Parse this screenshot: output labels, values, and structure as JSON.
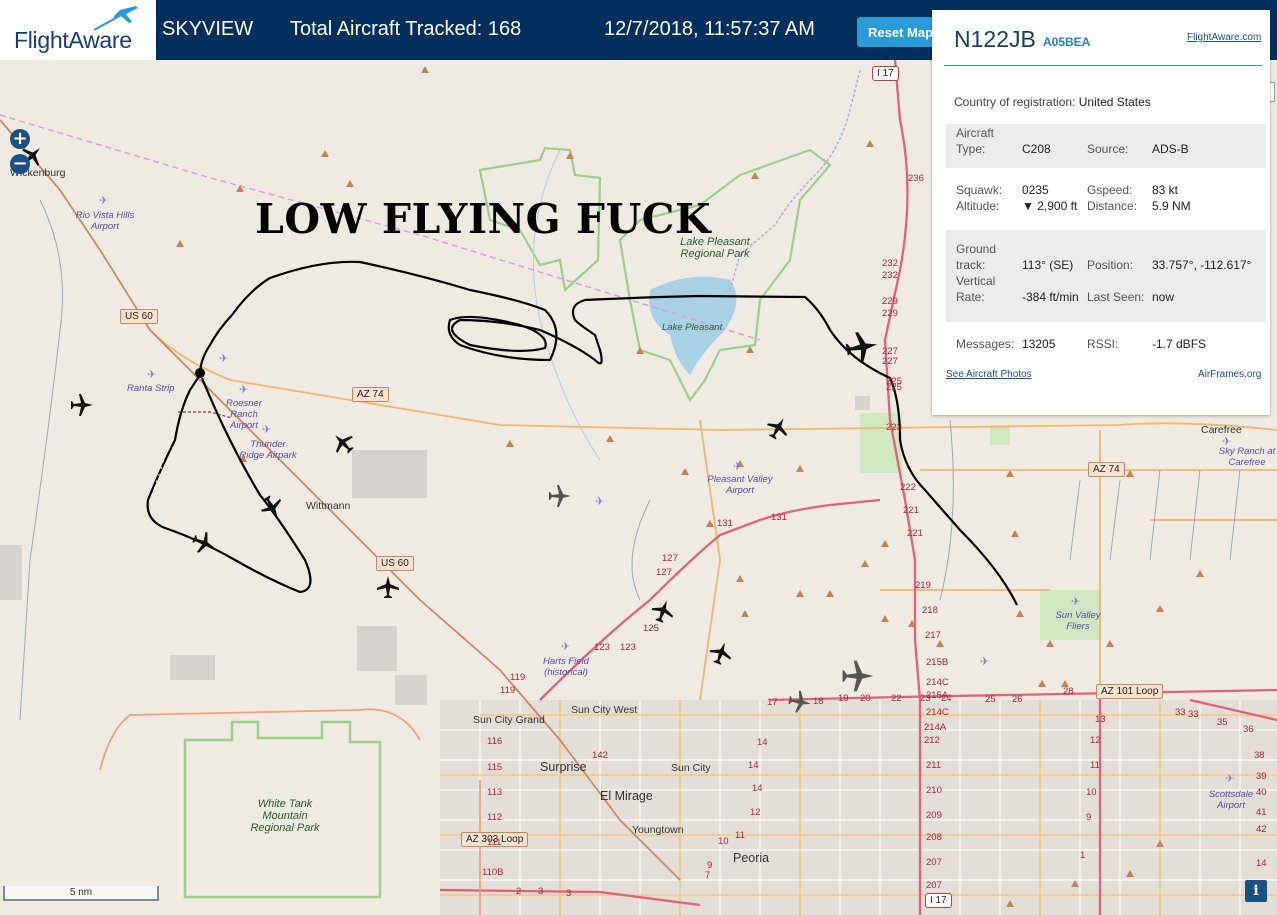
{
  "header": {
    "logo_text": "FlightAware",
    "app_name": "SKYVIEW",
    "tracked": "Total Aircraft Tracked: 168",
    "datetime": "12/7/2018, 11:57:37 AM",
    "reset_label": "Reset Map"
  },
  "map": {
    "zoom_in": "+",
    "zoom_out": "−",
    "scale_label": "5 nm",
    "info_label": "i",
    "overlay_text": "LOW FLYING FUCK",
    "places": [
      {
        "id": "wickenburg",
        "text": "Wickenburg"
      },
      {
        "id": "wittmann",
        "text": "Wittmann"
      },
      {
        "id": "sun-city-grand",
        "text": "Sun City Grand"
      },
      {
        "id": "sun-city-west",
        "text": "Sun City West"
      },
      {
        "id": "surprise",
        "text": "Surprise"
      },
      {
        "id": "sun-city",
        "text": "Sun City"
      },
      {
        "id": "el-mirage",
        "text": "El Mirage"
      },
      {
        "id": "youngtown",
        "text": "Youngtown"
      },
      {
        "id": "peoria",
        "text": "Peoria"
      },
      {
        "id": "carefree",
        "text": "Carefree"
      },
      {
        "id": "lake-pleasant",
        "text": "Lake Pleasant"
      }
    ],
    "parks": [
      {
        "id": "lake-pleasant-park",
        "text": "Lake Pleasant Regional Park"
      },
      {
        "id": "white-tank",
        "text": "White Tank Mountain Regional Park"
      }
    ],
    "airports": [
      {
        "id": "rio-vista",
        "text": "Rio Vista Hills Airport"
      },
      {
        "id": "ranta",
        "text": "Ranta Strip"
      },
      {
        "id": "roesner",
        "text": "Roesner Ranch Airport"
      },
      {
        "id": "thunder",
        "text": "Thunder Ridge Airpark"
      },
      {
        "id": "pleasant-valley",
        "text": "Pleasant Valley Airport"
      },
      {
        "id": "harts",
        "text": "Harts Field (historical)"
      },
      {
        "id": "sun-valley",
        "text": "Sun Valley Fliers"
      },
      {
        "id": "sky-ranch",
        "text": "Sky Ranch at Carefree"
      },
      {
        "id": "scottsdale",
        "text": "Scottsdale Airport"
      }
    ],
    "shields": [
      {
        "id": "us60-a",
        "text": "US 60"
      },
      {
        "id": "us60-b",
        "text": "US 60"
      },
      {
        "id": "az74-a",
        "text": "AZ 74"
      },
      {
        "id": "az74-b",
        "text": "AZ 74"
      },
      {
        "id": "i17-top",
        "text": "I 17"
      },
      {
        "id": "i17-bottom",
        "text": "I 17"
      },
      {
        "id": "az101",
        "text": "AZ 101 Loop"
      },
      {
        "id": "az303",
        "text": "AZ 303 Loop"
      }
    ],
    "exits": [
      "236",
      "232",
      "232",
      "229",
      "229",
      "227",
      "227",
      "225",
      "225",
      "223",
      "222",
      "221",
      "221",
      "219",
      "218",
      "217",
      "215B",
      "214C",
      "215A",
      "214C",
      "214A",
      "212",
      "211",
      "210",
      "209",
      "208",
      "207",
      "207",
      "131",
      "131",
      "127",
      "127",
      "125",
      "123",
      "123",
      "119",
      "119",
      "116",
      "115",
      "113",
      "112",
      "111",
      "110B",
      "142",
      "14",
      "14",
      "14",
      "12",
      "11",
      "10",
      "9",
      "7",
      "17",
      "18",
      "19",
      "20",
      "22",
      "23",
      "24",
      "25",
      "26",
      "28",
      "33",
      "33",
      "35",
      "36",
      "38",
      "39",
      "40",
      "41",
      "42",
      "14",
      "13",
      "12",
      "11",
      "10",
      "9",
      "1",
      "2",
      "3",
      "3"
    ]
  },
  "panel": {
    "callsign": "N122JB",
    "hex": "A05BEA",
    "fa_link": "FlightAware.com",
    "country_label": "Country of registration:",
    "country_value": "United States",
    "aircraft_type_label_1": "Aircraft",
    "aircraft_type_label_2": "Type:",
    "aircraft_type": "C208",
    "source_label": "Source:",
    "source": "ADS-B",
    "squawk_label": "Squawk:",
    "squawk": "0235",
    "altitude_label": "Altitude:",
    "altitude": "▼ 2,900 ft",
    "gspeed_label": "Gspeed:",
    "gspeed": "83 kt",
    "distance_label": "Distance:",
    "distance": "5.9 NM",
    "track_label_1": "Ground",
    "track_label_2": "track:",
    "track": "113° (SE)",
    "position_label": "Position:",
    "position": "33.757°, -112.617°",
    "vrate_label_1": "Vertical",
    "vrate_label_2": "Rate:",
    "vrate": "-384 ft/min",
    "lastseen_label": "Last Seen:",
    "lastseen": "now",
    "messages_label": "Messages:",
    "messages": "13205",
    "rssi_label": "RSSI:",
    "rssi": "-1.7 dBFS",
    "photos_link": "See Aircraft Photos",
    "airframes_link": "AirFrames.org"
  },
  "colors": {
    "header_bg": "#002f5d",
    "accent": "#2a9ad8",
    "interstate": "#e2607a",
    "arterial": "#f2b56b",
    "park_border": "#9ccf8c"
  }
}
